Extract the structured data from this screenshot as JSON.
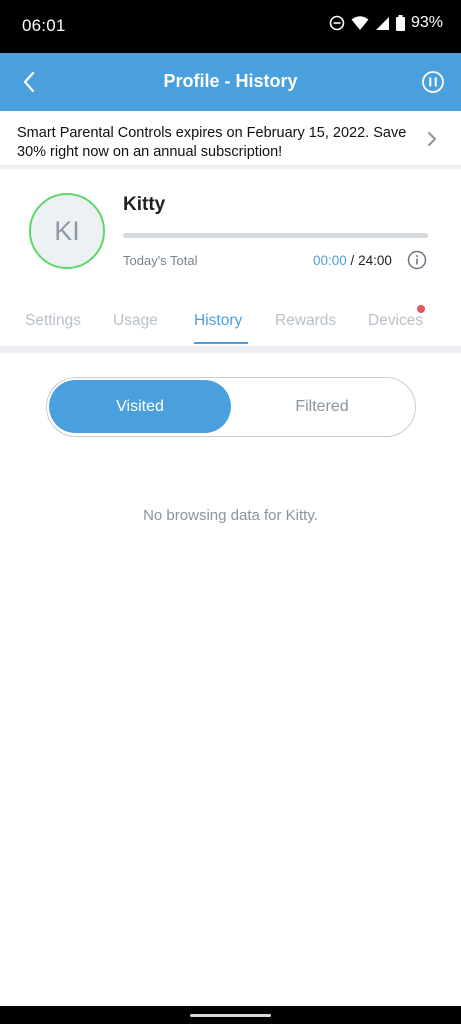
{
  "status_bar": {
    "time": "06:01",
    "battery": "93%",
    "icons": [
      "do-not-disturb-icon",
      "wifi-icon",
      "signal-icon",
      "battery-icon"
    ]
  },
  "app_bar": {
    "title": "Profile - History",
    "back_icon": "back-arrow-icon",
    "pause_icon": "pause-circle-icon",
    "color": "#4a9fdd"
  },
  "promo": {
    "text": "Smart Parental Controls expires on February 15, 2022. Save 30% right now on an annual subscription!",
    "icon": "chevron-right-icon"
  },
  "profile": {
    "initials": "KI",
    "name": "Kitty",
    "total_label": "Today's Total",
    "used": "00:00",
    "separator": " / ",
    "limit": "24:00",
    "progress_fraction": 0.0,
    "avatar_ring_color": "#5dd86a"
  },
  "tabs": [
    {
      "label": "Settings",
      "active": false
    },
    {
      "label": "Usage",
      "active": false
    },
    {
      "label": "History",
      "active": true
    },
    {
      "label": "Rewards",
      "active": false
    },
    {
      "label": "Devices",
      "active": false,
      "badge": true
    }
  ],
  "segments": {
    "visited": "Visited",
    "filtered": "Filtered",
    "selected": "Visited"
  },
  "empty_message": "No browsing data for Kitty."
}
